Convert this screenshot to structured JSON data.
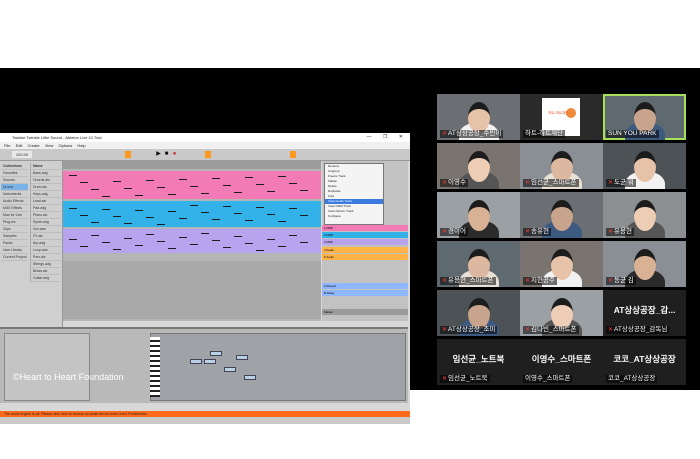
{
  "daw": {
    "window_title": "Twinkle Twinkle Little Sound - Ableton Live 10 Trial",
    "window_controls": "—  ❐  ✕",
    "menu": [
      "File",
      "Edit",
      "Create",
      "View",
      "Options",
      "Help"
    ],
    "tempo": "120.00",
    "browser_cols": [
      "Collections",
      "Name"
    ],
    "browser_places": [
      "Favorites",
      "Sounds",
      "Drums",
      "Instruments",
      "Audio Effects",
      "MIDI Effects",
      "Max for Live",
      "Plug-ins",
      "Clips",
      "Samples",
      "Packs",
      "User Library",
      "Current Project"
    ],
    "browser_files": [
      "Bass.adg",
      "Chords.alc",
      "Drum.alc",
      "Keys.adg",
      "Lead.alc",
      "Pad.adg",
      "Piano.alc",
      "Synth.adg",
      "Vox.wav",
      "FX.alc",
      "Arp.adg",
      "Loop.wav",
      "Perc.alc",
      "Strings.adg",
      "Brass.alc",
      "Guitar.adg"
    ],
    "context_menu": [
      "Rename",
      "Ungroup",
      "Freeze Track",
      "Flatten",
      "Delete",
      "Duplicate",
      "Fold",
      "Insert Audio Track",
      "Insert MIDI Track",
      "Insert Return Track",
      "Configure"
    ],
    "context_selected_index": 7,
    "track_headers": [
      "1 MIDI",
      "2 MIDI",
      "3 MIDI",
      "4 Audio",
      "5 Audio",
      "A Reverb",
      "B Delay",
      "Master"
    ],
    "status": "The audio engine is off. Please click here to choose an audio device from Live's Preferences."
  },
  "copyright": "©Heart to Heart Foundation",
  "participants": [
    {
      "name": "AT상상공장_수빈이",
      "mic_muted": true
    },
    {
      "name": "하트-하트재단",
      "mic_muted": false,
      "logo_text": "하트-하트재단"
    },
    {
      "name": "SUN YOU PARK",
      "mic_muted": false,
      "active": true
    },
    {
      "name": "이영수",
      "mic_muted": true
    },
    {
      "name": "임선균_스마트폰",
      "mic_muted": true
    },
    {
      "name": "도균 워",
      "mic_muted": true
    },
    {
      "name": "경이어",
      "mic_muted": true
    },
    {
      "name": "송유현",
      "mic_muted": true
    },
    {
      "name": "유용현",
      "mic_muted": true
    },
    {
      "name": "유용현_스마트폰",
      "mic_muted": true
    },
    {
      "name": "지현공주",
      "mic_muted": true
    },
    {
      "name": "동균 김",
      "mic_muted": true
    },
    {
      "name": "AT상상공장_조미",
      "mic_muted": true
    },
    {
      "name": "김다빈_스마트폰",
      "mic_muted": true
    },
    {
      "name": "AT상상공장_감독님",
      "mic_muted": true,
      "big_label": "AT상상공장_감..."
    },
    {
      "name": "임선균_노트북",
      "mic_muted": true,
      "big_label": "임선균_노트북"
    },
    {
      "name": "이영수_스마트폰",
      "mic_muted": false,
      "big_label": "이영수_스마트폰"
    },
    {
      "name": "코코_AT상상공장",
      "mic_muted": false,
      "big_label": "코코_AT상상공장"
    }
  ]
}
